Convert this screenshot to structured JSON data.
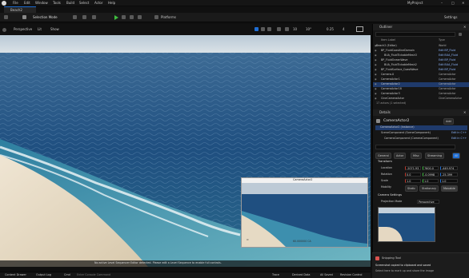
{
  "menu": {
    "items": [
      "File",
      "Edit",
      "Window",
      "Tools",
      "Build",
      "Select",
      "Actor",
      "Help"
    ],
    "project": "MyProject"
  },
  "tab": {
    "label": "Beach2"
  },
  "toolbar": {
    "mode": "Selection Mode",
    "platforms": "Platforms",
    "settings": "Settings"
  },
  "viewport": {
    "perspective": "Perspective",
    "lit": "Lit",
    "show": "Show",
    "fov": "10",
    "grid": "10°",
    "scale": "0.25",
    "speed": "4",
    "footer_msg": "No active Level Sequencer Editor detected. Please edit a Level Sequence to enable full controls."
  },
  "preview": {
    "title": "CameraActor2",
    "coords": "60.000000 CA"
  },
  "outliner": {
    "title": "Outliner",
    "col_label": "Item Label",
    "col_type": "Type",
    "rows": [
      {
        "label": "Beach2 (Editor)",
        "type": "World"
      },
      {
        "label": "BP_FluidCoastlineDomain",
        "type": "Edit BP_Fluid"
      },
      {
        "label": "BUA_FluidTickableMesh3",
        "type": "Edit BUA_Fluid"
      },
      {
        "label": "BP_FluidOceanWave",
        "type": "Edit BP_Fluid"
      },
      {
        "label": "BUA_FluidTickableMesh2",
        "type": "Edit BUA_Fluid"
      },
      {
        "label": "BP_FluidSurface_CoastWave",
        "type": "Edit BP_Fluid"
      },
      {
        "label": "Camera.0",
        "type": "CameraActor"
      },
      {
        "label": "CameraActor1",
        "type": "CameraActor"
      },
      {
        "label": "CameraActor2",
        "type": "CameraActor"
      },
      {
        "label": "CameraActor18",
        "type": "CameraActor"
      },
      {
        "label": "CameraActor3",
        "type": "CameraActor"
      },
      {
        "label": "CineCameraActor",
        "type": "CineCameraActor"
      }
    ],
    "count": "17 actors (1 selected)"
  },
  "details": {
    "title": "Details",
    "actor": "CameraActor2",
    "add": "Add",
    "instance": "CameraActor2 (Instance)",
    "components": [
      {
        "label": "SceneComponent (SceneComponent)",
        "link": "Edit in C++"
      },
      {
        "label": "CameraComponent (CameraComponent)",
        "link": "Edit in C++"
      }
    ],
    "search_placeholder": "Search",
    "filter_tabs": [
      "General",
      "Actor",
      "Misc",
      "Streaming",
      "All"
    ],
    "transform_title": "Transform",
    "location_label": "Location",
    "location": [
      "-2071.93",
      "7600.0",
      "-449.974"
    ],
    "rotation_label": "Rotation",
    "rotation": [
      "0.0",
      "-0.0998",
      "-25.399"
    ],
    "scale_label": "Scale",
    "scale": [
      "1.0",
      "1.0",
      "1.0"
    ],
    "mobility_label": "Mobility",
    "mobility": [
      "Static",
      "Stationary",
      "Movable"
    ],
    "camera_settings_title": "Camera Settings",
    "projection_label": "Projection Mode",
    "projection_value": "Perspective"
  },
  "toast": {
    "title": "Snipping Tool",
    "line1": "Screenshot copied to clipboard and saved",
    "line2": "Select here to mark up and share the image"
  },
  "statusbar": {
    "content_drawer": "Content Drawer",
    "output_log": "Output Log",
    "cmd": "Cmd",
    "cmd_placeholder": "Enter Console Command",
    "trace": "Trace",
    "derived": "Derived Data",
    "all_saved": "All Saved",
    "revision": "Revision Control"
  },
  "colors": {
    "accent": "#1f6ed4",
    "selection": "#1f3a6b",
    "ocean": "#2d5a86",
    "sand": "#e8dcc8",
    "sky": "#cfdbe4"
  }
}
